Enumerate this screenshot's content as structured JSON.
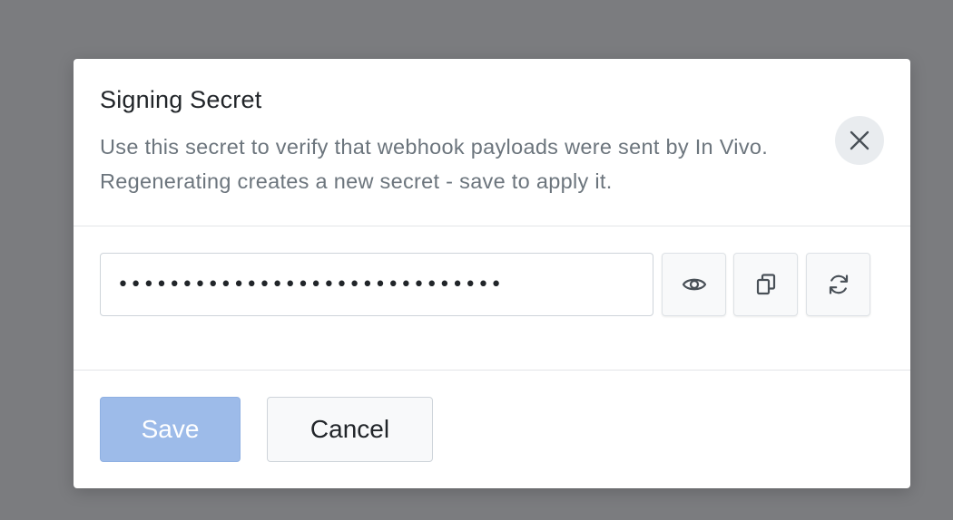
{
  "dialog": {
    "title": "Signing Secret",
    "description": "Use this secret to verify that webhook payloads were sent by In Vivo. Regenerating creates a new secret - save to apply it.",
    "close_icon": "close-icon"
  },
  "secret": {
    "masked_value": "••••••••••••••••••••••••••••••",
    "actions": [
      {
        "name": "show-secret-button",
        "icon": "eye-icon"
      },
      {
        "name": "copy-secret-button",
        "icon": "copy-icon"
      },
      {
        "name": "regenerate-secret-button",
        "icon": "refresh-icon"
      }
    ]
  },
  "footer": {
    "save_label": "Save",
    "cancel_label": "Cancel"
  },
  "colors": {
    "overlay": "#7b7c7f",
    "primary_disabled": "#9dbbe9",
    "text_muted": "#6c757d",
    "close_bg": "#e9ecef"
  }
}
